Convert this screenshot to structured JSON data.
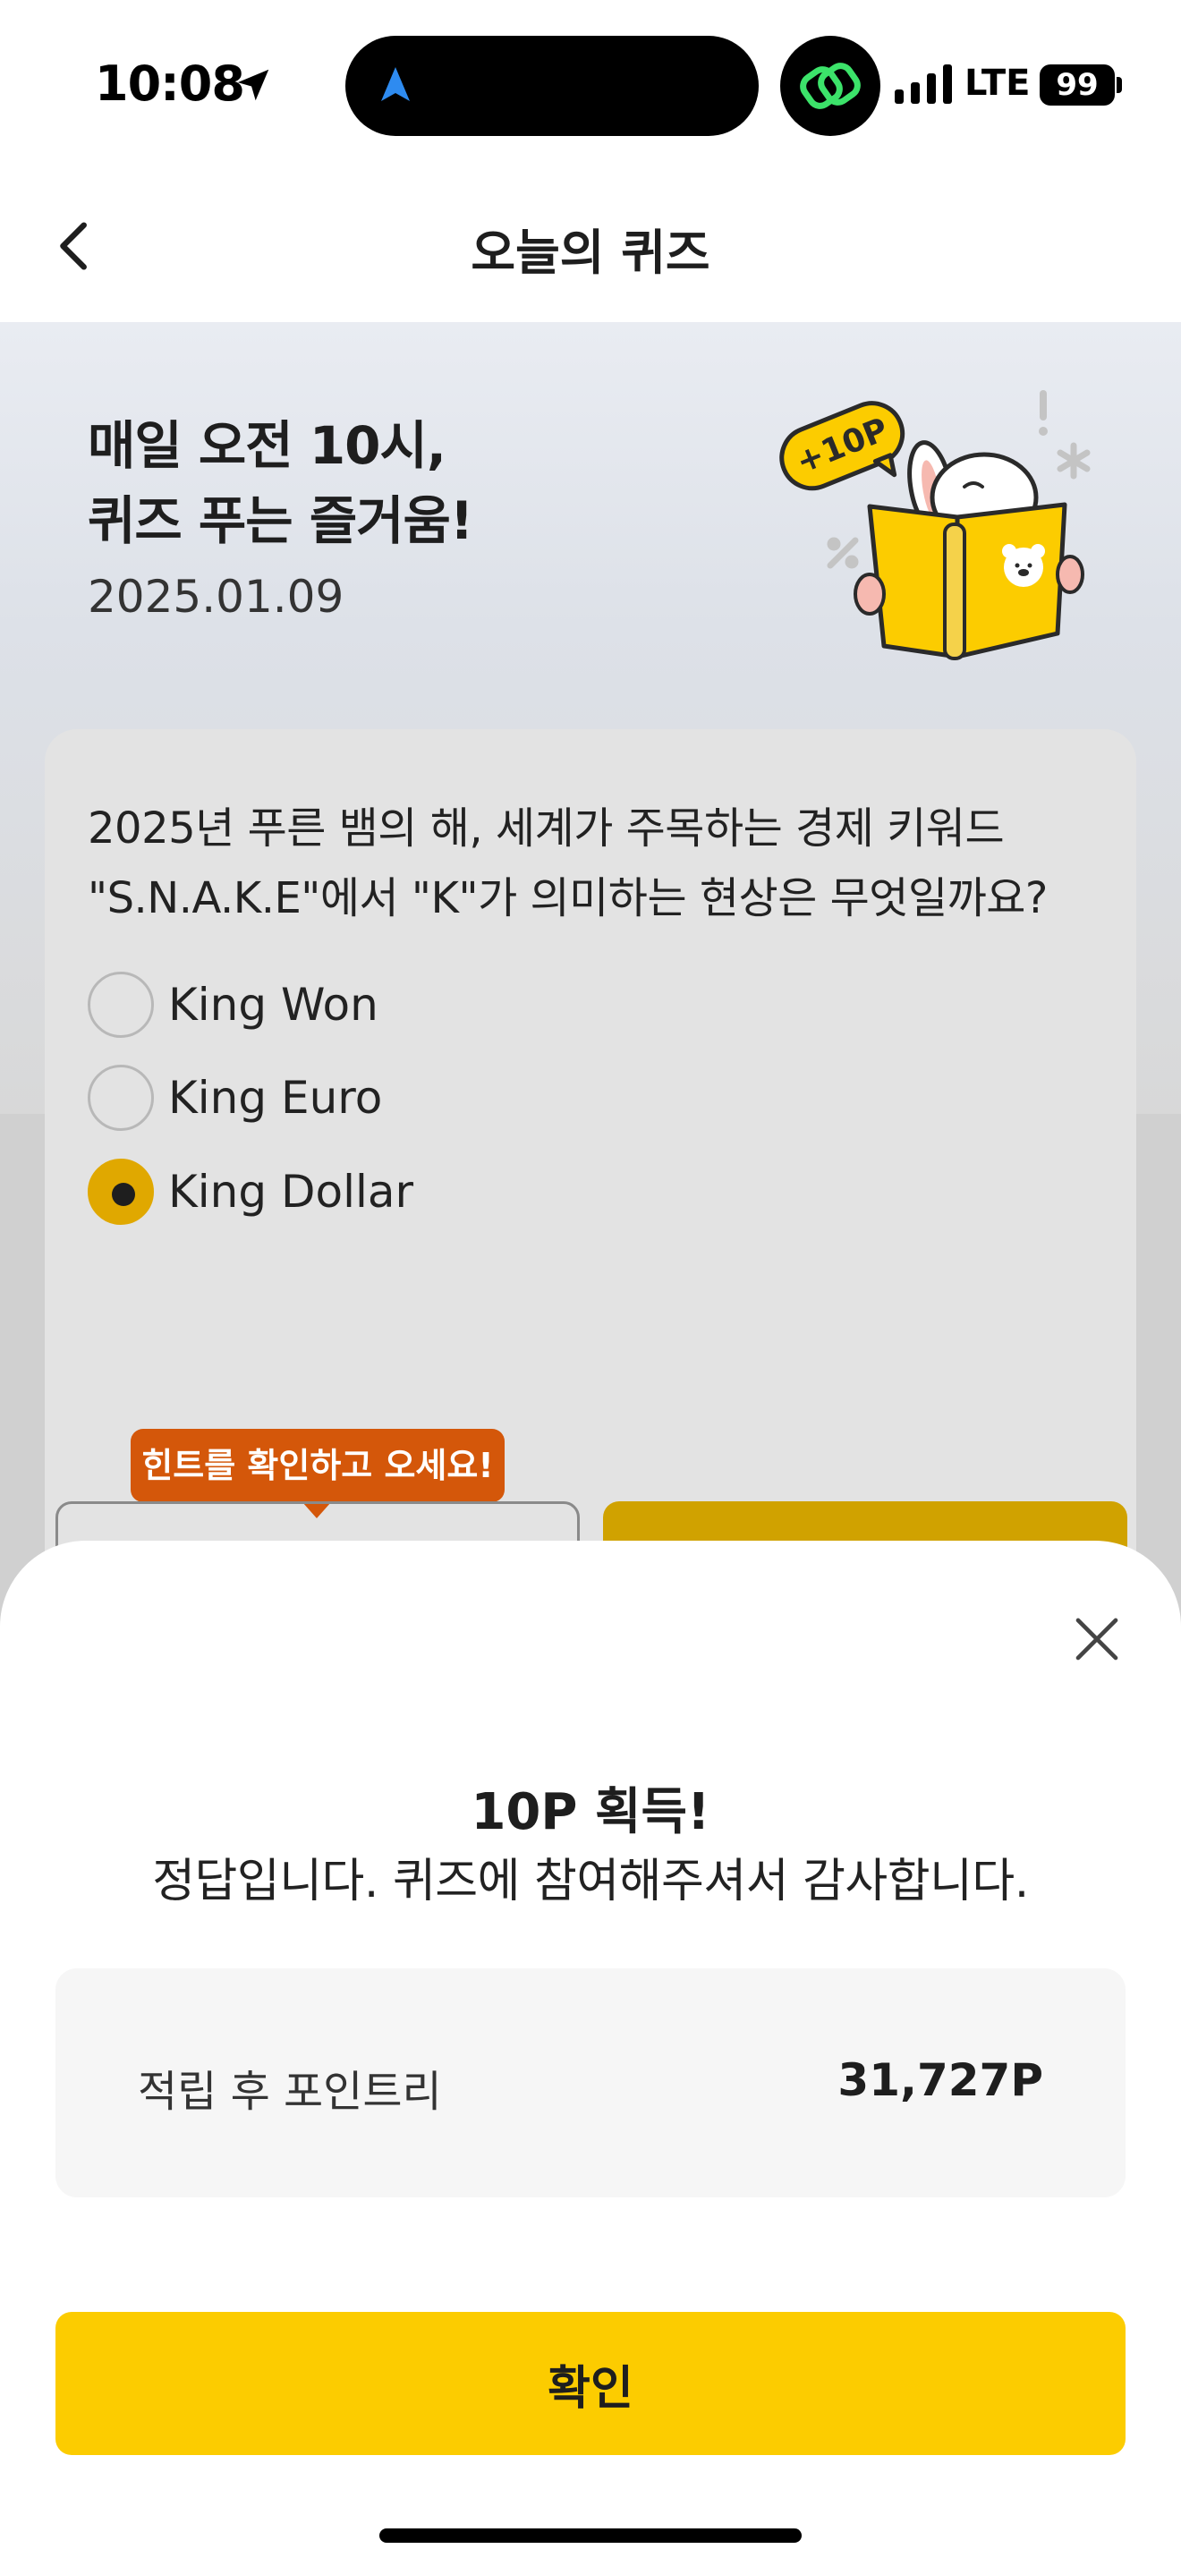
{
  "status_bar": {
    "time": "10:08",
    "network": "LTE",
    "battery": "99"
  },
  "header": {
    "title": "오늘의 퀴즈"
  },
  "hero": {
    "title_line1": "매일 오전 10시,",
    "title_line2": "퀴즈 푸는 즐거움!",
    "date": "2025.01.09",
    "badge_text": "+10P"
  },
  "quiz": {
    "question_line1": "2025년 푸른 뱀의 해, 세계가 주목하는 경제 키워드",
    "question_line2": "\"S.N.A.K.E\"에서 \"K\"가 의미하는 현상은 무엇일까요?",
    "options": [
      {
        "label": "King Won",
        "selected": false
      },
      {
        "label": "King Euro",
        "selected": false
      },
      {
        "label": "King Dollar",
        "selected": true
      }
    ],
    "hint_tooltip": "힌트를 확인하고 오세요!"
  },
  "result_sheet": {
    "title": "10P 획득!",
    "message": "정답입니다. 퀴즈에 참여해주셔서 감사합니다.",
    "points_label": "적립 후 포인트리",
    "points_value": "31,727P",
    "confirm_label": "확인"
  },
  "colors": {
    "accent_yellow": "#fccc00",
    "hint_orange": "#d4570a",
    "selected_radio": "#e0a800"
  }
}
